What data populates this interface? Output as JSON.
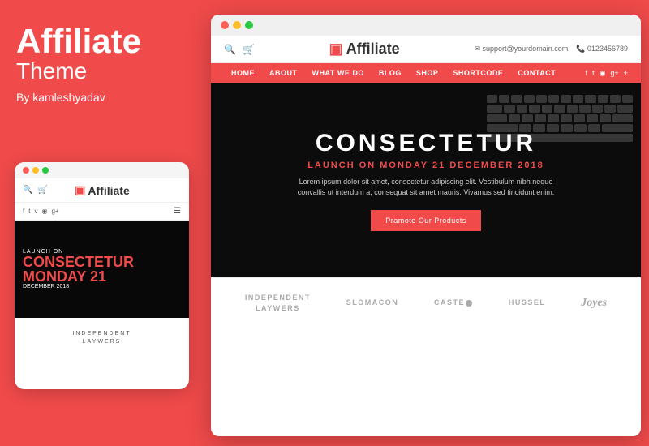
{
  "left": {
    "title": "Affiliate",
    "subtitle": "Theme",
    "by": "By kamleshyadav"
  },
  "mobile": {
    "hero_launch": "LAUNCH ON",
    "hero_title": "CONSECTETUR",
    "hero_title_red": "MONDAY 21",
    "hero_sub": "DECEMBER 2018",
    "brand_line1": "INDEPENDENT",
    "brand_line2": "LAYWERS",
    "logo": "Affiliate"
  },
  "desktop": {
    "dots": [
      "red",
      "yellow",
      "green"
    ],
    "header": {
      "logo": "Affiliate",
      "email": "support@yourdomain.com",
      "phone": "0123456789"
    },
    "nav_items": [
      "HOME",
      "ABOUT",
      "WHAT WE DO",
      "BLOG",
      "SHOP",
      "SHORTCODE",
      "CONTACT"
    ],
    "hero": {
      "title": "CONSECTETUR",
      "subtitle_prefix": "LAUNCH ON",
      "subtitle_red": "MONDAY 21",
      "subtitle_suffix": "DECEMBER 2018",
      "body_text": "Lorem ipsum dolor sit amet, consectetur adipiscing elit. Vestibulum nibh neque convallis ut interdum a, consequat sit amet mauris. Vivamus sed tincidunt enim.",
      "button": "Pramote Our Products"
    },
    "brands": [
      {
        "label": "INDEPENDENT\nLAYWERS",
        "style": "normal"
      },
      {
        "label": "SLOMACON",
        "style": "normal"
      },
      {
        "label": "CASTE●",
        "style": "casted"
      },
      {
        "label": "HUSSEL",
        "style": "normal"
      },
      {
        "label": "Joyes",
        "style": "cursive"
      }
    ]
  }
}
